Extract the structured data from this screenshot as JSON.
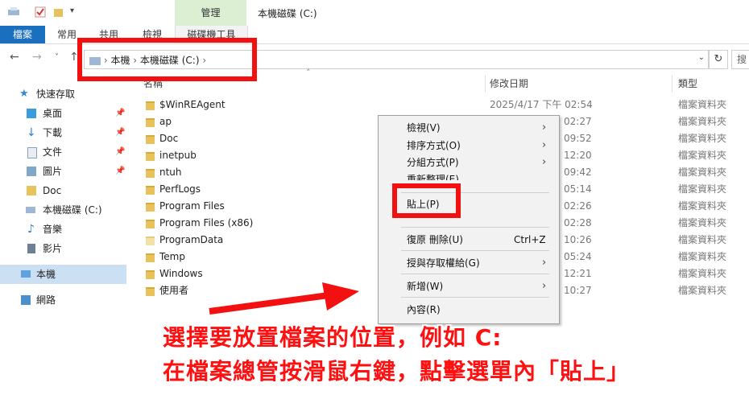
{
  "window": {
    "title": "本機磁碟 (C:)",
    "manage_tab": "管理"
  },
  "ribbon": {
    "tabs": [
      "檔案",
      "常用",
      "共用",
      "檢視",
      "磁碟機工具"
    ]
  },
  "address": {
    "crumbs": [
      "本機",
      "本機磁碟 (C:)"
    ],
    "search_placeholder": "搜"
  },
  "sidebar": {
    "items": [
      {
        "label": "快速存取",
        "icon": "star-icon",
        "pinned": false
      },
      {
        "label": "桌面",
        "icon": "desktop-icon",
        "pinned": true
      },
      {
        "label": "下載",
        "icon": "download-icon",
        "pinned": true
      },
      {
        "label": "文件",
        "icon": "document-icon",
        "pinned": true
      },
      {
        "label": "圖片",
        "icon": "pictures-icon",
        "pinned": true
      },
      {
        "label": "Doc",
        "icon": "folder-icon",
        "pinned": false
      },
      {
        "label": "本機磁碟 (C:)",
        "icon": "drive-icon",
        "pinned": false
      },
      {
        "label": "音樂",
        "icon": "music-icon",
        "pinned": false
      },
      {
        "label": "影片",
        "icon": "video-icon",
        "pinned": false
      },
      {
        "label": "本機",
        "icon": "computer-icon",
        "pinned": false
      },
      {
        "label": "網路",
        "icon": "network-icon",
        "pinned": false
      }
    ]
  },
  "columns": {
    "name": "名稱",
    "date": "修改日期",
    "type": "類型"
  },
  "files": [
    {
      "name": "$WinREAgent",
      "date": "2025/4/17 下午 02:54",
      "type": "檔案資料夾"
    },
    {
      "name": "ap",
      "date": "02:27",
      "type": "檔案資料夾"
    },
    {
      "name": "Doc",
      "date": "09:52",
      "type": "檔案資料夾"
    },
    {
      "name": "inetpub",
      "date": "12:20",
      "type": "檔案資料夾"
    },
    {
      "name": "ntuh",
      "date": "09:42",
      "type": "檔案資料夾"
    },
    {
      "name": "PerfLogs",
      "date": "05:14",
      "type": "檔案資料夾"
    },
    {
      "name": "Program Files",
      "date": "02:26",
      "type": "檔案資料夾"
    },
    {
      "name": "Program Files (x86)",
      "date": "02:28",
      "type": "檔案資料夾"
    },
    {
      "name": "ProgramData",
      "date": "10:26",
      "type": "檔案資料夾"
    },
    {
      "name": "Temp",
      "date": "05:24",
      "type": "檔案資料夾"
    },
    {
      "name": "Windows",
      "date": "12:21",
      "type": "檔案資料夾"
    },
    {
      "name": "使用者",
      "date": "10:27",
      "type": "檔案資料夾"
    }
  ],
  "context_menu": {
    "view": "檢視(V)",
    "sort": "排序方式(O)",
    "group": "分組方式(P)",
    "refresh": "重新整理(E)",
    "paste": "貼上(P)",
    "undo": "復原 刪除(U)",
    "undo_shortcut": "Ctrl+Z",
    "grant": "授與存取權給(G)",
    "new": "新增(W)",
    "properties": "內容(R)"
  },
  "annotation": {
    "line1": "選擇要放置檔案的位置，例如 C:",
    "line2": "在檔案總管按滑鼠右鍵，點擊選單內「貼上」"
  },
  "colors": {
    "accent": "#1a6fbf",
    "annotation_red": "#f21010",
    "manage_tab_bg": "#dcefd3"
  }
}
